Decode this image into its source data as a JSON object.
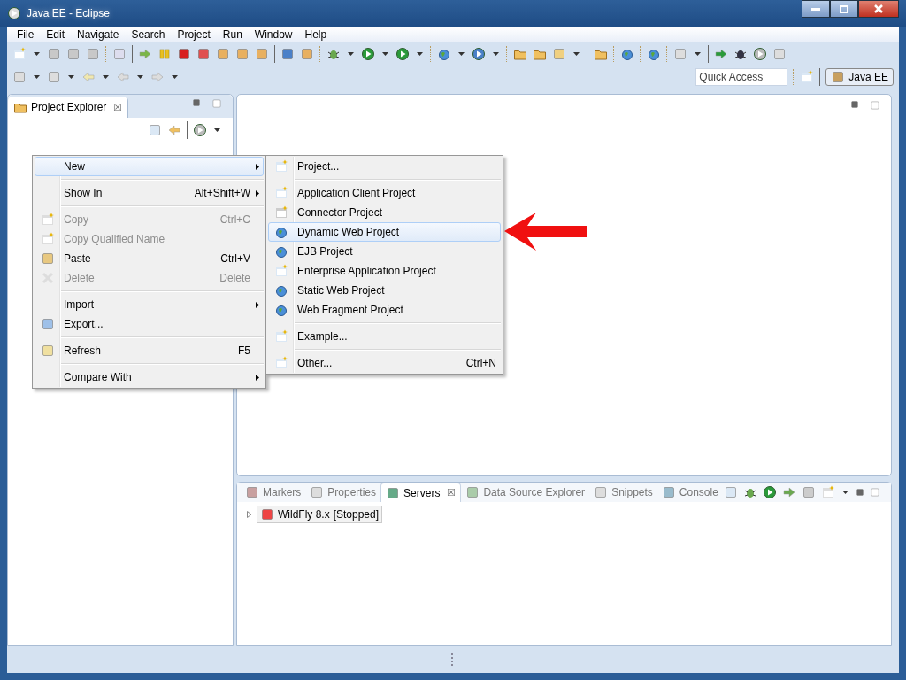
{
  "window": {
    "title": "Java EE - Eclipse"
  },
  "menu_bar": [
    "File",
    "Edit",
    "Navigate",
    "Search",
    "Project",
    "Run",
    "Window",
    "Help"
  ],
  "quick_access": {
    "placeholder": "Quick Access"
  },
  "perspective": {
    "label": "Java EE",
    "selected": true
  },
  "project_explorer": {
    "tab": "Project Explorer",
    "close": "☒"
  },
  "context_menu": [
    {
      "kind": "item",
      "label": "New",
      "submenu": true,
      "disabled": false,
      "selected": true
    },
    {
      "kind": "separator"
    },
    {
      "kind": "item",
      "label": "Show In",
      "shortcut": "Alt+Shift+W",
      "submenu": true,
      "disabled": false,
      "selected": false
    },
    {
      "kind": "separator"
    },
    {
      "kind": "item",
      "label": "Copy",
      "shortcut": "Ctrl+C",
      "submenu": false,
      "disabled": true,
      "selected": false
    },
    {
      "kind": "item",
      "label": "Copy Qualified Name",
      "submenu": false,
      "disabled": true,
      "selected": false
    },
    {
      "kind": "item",
      "label": "Paste",
      "shortcut": "Ctrl+V",
      "submenu": false,
      "disabled": false,
      "selected": false
    },
    {
      "kind": "item",
      "label": "Delete",
      "shortcut": "Delete",
      "submenu": false,
      "disabled": true,
      "selected": false
    },
    {
      "kind": "separator"
    },
    {
      "kind": "item",
      "label": "Import",
      "submenu": true,
      "disabled": false,
      "selected": false
    },
    {
      "kind": "item",
      "label": "Export...",
      "submenu": false,
      "disabled": false,
      "selected": false
    },
    {
      "kind": "separator"
    },
    {
      "kind": "item",
      "label": "Refresh",
      "shortcut": "F5",
      "submenu": false,
      "disabled": false,
      "selected": false
    },
    {
      "kind": "separator"
    },
    {
      "kind": "item",
      "label": "Compare With",
      "submenu": true,
      "disabled": false,
      "selected": false
    }
  ],
  "new_submenu": [
    {
      "kind": "item",
      "label": "Project...",
      "selected": false
    },
    {
      "kind": "separator"
    },
    {
      "kind": "item",
      "label": "Application Client Project",
      "selected": false
    },
    {
      "kind": "item",
      "label": "Connector Project",
      "selected": false
    },
    {
      "kind": "item",
      "label": "Dynamic Web Project",
      "selected": true
    },
    {
      "kind": "item",
      "label": "EJB Project",
      "selected": false
    },
    {
      "kind": "item",
      "label": "Enterprise Application Project",
      "selected": false
    },
    {
      "kind": "item",
      "label": "Static Web Project",
      "selected": false
    },
    {
      "kind": "item",
      "label": "Web Fragment Project",
      "selected": false
    },
    {
      "kind": "separator"
    },
    {
      "kind": "item",
      "label": "Example...",
      "selected": false
    },
    {
      "kind": "separator"
    },
    {
      "kind": "item",
      "label": "Other...",
      "shortcut": "Ctrl+N",
      "selected": false
    }
  ],
  "bottom_tabs": [
    {
      "label": "Markers",
      "selected": false
    },
    {
      "label": "Properties",
      "selected": false
    },
    {
      "label": "Servers",
      "selected": true,
      "close": "☒"
    },
    {
      "label": "Data Source Explorer",
      "selected": false
    },
    {
      "label": "Snippets",
      "selected": false
    },
    {
      "label": "Console",
      "selected": false
    }
  ],
  "servers": [
    {
      "name": "WildFly 8.x",
      "status": "[Stopped]",
      "expanded": false
    }
  ]
}
